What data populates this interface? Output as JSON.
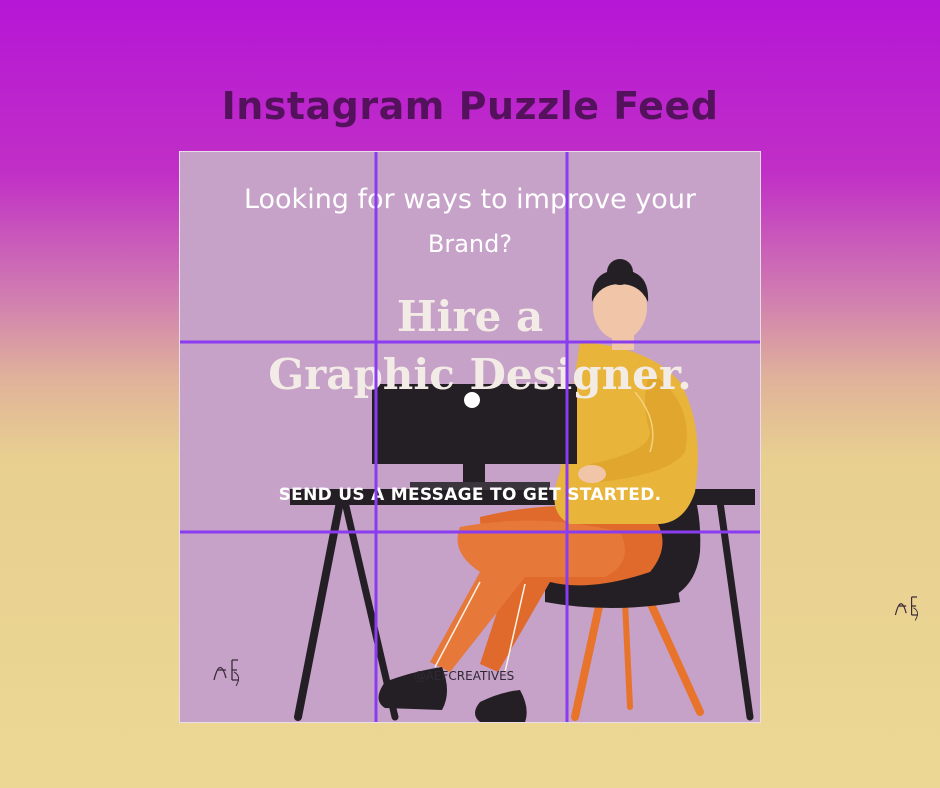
{
  "page": {
    "title": "Instagram Puzzle Feed"
  },
  "post": {
    "headline_line1": "Looking for ways to improve your",
    "headline_line2": "Brand?",
    "hire_line1": "Hire a",
    "hire_line2": "Graphic Designer.",
    "cta": "SEND US A MESSAGE TO GET STARTED.",
    "handle": "@AEFCREATIVES",
    "signature": "AEF"
  },
  "grid": {
    "rows": 3,
    "columns": 3,
    "line_color": "#8a3cf0"
  },
  "colors": {
    "background_top": "#b616d6",
    "background_bottom": "#ecd894",
    "title": "#55125c",
    "post_background": "#c6a1c8",
    "sweater": "#e8b43a",
    "pants": "#e06a2c",
    "chair": "#e8742c",
    "dark": "#231f24",
    "skin": "#f1c6a8"
  },
  "icons": {
    "signature_mark": "aef-signature-icon"
  }
}
